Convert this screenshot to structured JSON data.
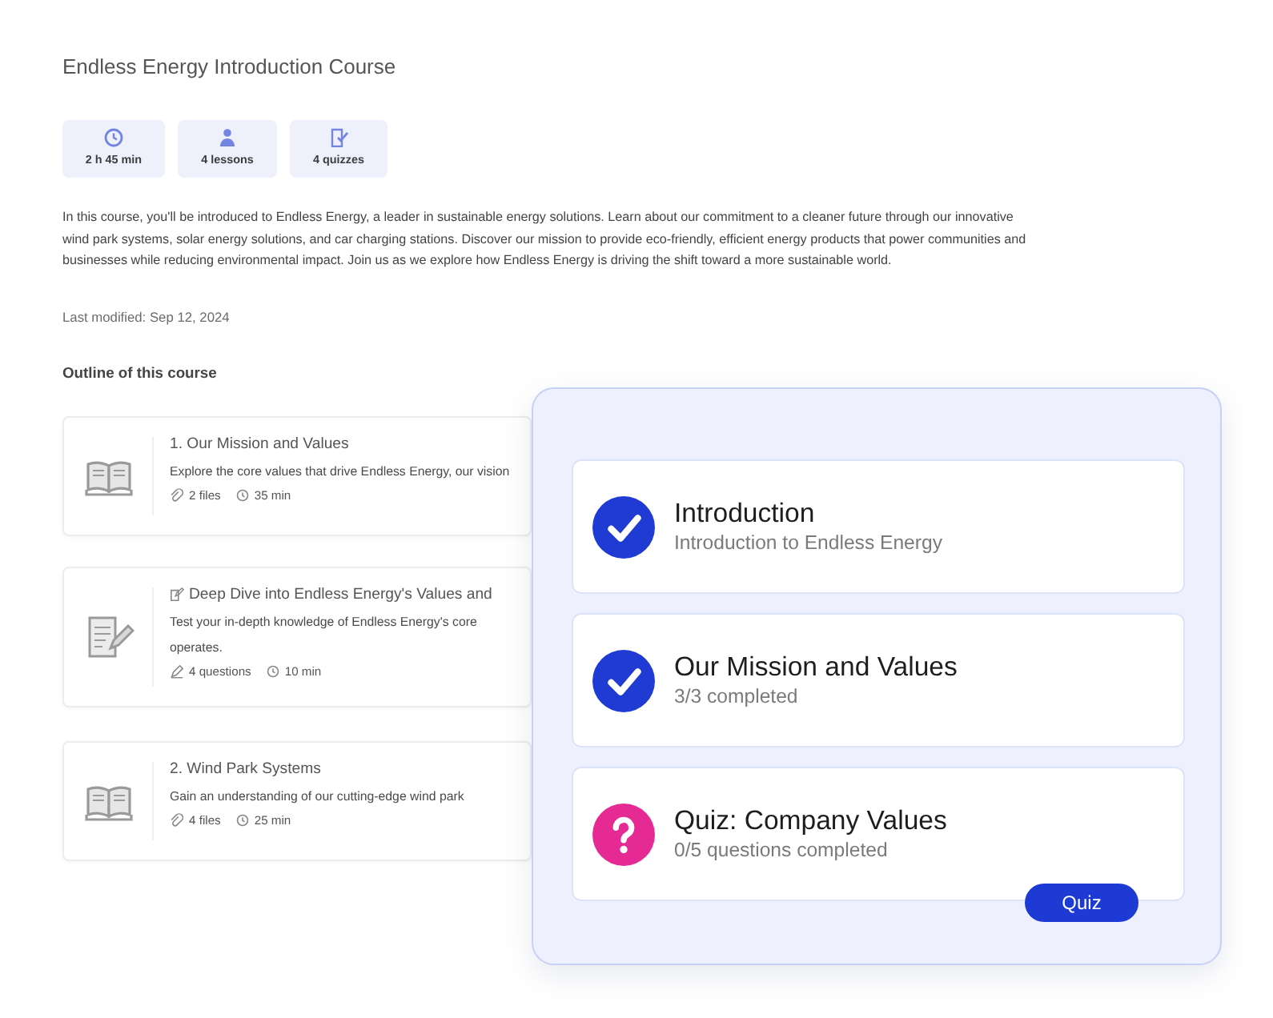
{
  "course": {
    "title": "Endless Energy Introduction Course",
    "stats": [
      {
        "kind": "duration",
        "text": "2 h 45 min"
      },
      {
        "kind": "lessons",
        "text": "4 lessons"
      },
      {
        "kind": "quizzes",
        "text": "4 quizzes"
      }
    ],
    "description": "In this course, you'll be introduced to Endless Energy, a leader in sustainable energy solutions. Learn about our commitment to a cleaner future through our innovative wind park systems, solar energy solutions, and car charging stations. Discover our mission to provide eco-friendly, efficient energy products that power communities and businesses while reducing environmental impact. Join us as we explore how Endless Energy is driving the shift toward a more sustainable world.",
    "last_modified": "Last modified: Sep 12, 2024",
    "outline_heading": "Outline of this course",
    "outline": [
      {
        "kind": "lesson",
        "title": "1. Our Mission and Values",
        "description_lines": [
          "Explore the core values that drive Endless Energy, our vision"
        ],
        "meta": [
          {
            "kind": "files",
            "text": "2 files"
          },
          {
            "kind": "duration",
            "text": "35 min"
          }
        ]
      },
      {
        "kind": "quiz",
        "title": "Deep Dive into Endless Energy's Values and",
        "description_lines": [
          "Test your in-depth knowledge of Endless Energy's core",
          "operates."
        ],
        "meta": [
          {
            "kind": "questions",
            "text": "4 questions"
          },
          {
            "kind": "duration",
            "text": "10 min"
          }
        ]
      },
      {
        "kind": "lesson",
        "title": "2. Wind Park Systems",
        "description_lines": [
          "Gain an understanding of our cutting-edge wind park"
        ],
        "meta": [
          {
            "kind": "files",
            "text": "4 files"
          },
          {
            "kind": "duration",
            "text": "25 min"
          }
        ]
      }
    ]
  },
  "progress_panel": {
    "items": [
      {
        "title": "Introduction",
        "subtitle": "Introduction to Endless Energy",
        "completed": true
      },
      {
        "title": "Our Mission and Values",
        "subtitle": "3/3 completed",
        "completed": true
      },
      {
        "title": "Quiz: Company Values",
        "subtitle": "0/5 questions completed",
        "completed": false,
        "button": "Quiz"
      }
    ]
  }
}
